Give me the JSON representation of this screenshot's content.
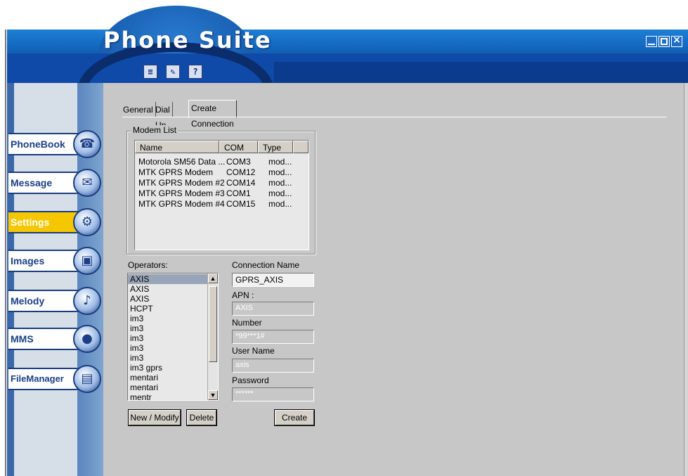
{
  "app": {
    "title": "Phone Suite"
  },
  "toolbar": {
    "icons": [
      "notes-icon",
      "edit-icon",
      "help-icon"
    ],
    "help_label": "?"
  },
  "sidebar": {
    "items": [
      {
        "label": "PhoneBook",
        "icon": "phone-icon",
        "active": false
      },
      {
        "label": "Message",
        "icon": "envelope-icon",
        "active": false
      },
      {
        "label": "Settings",
        "icon": "gear-icon",
        "active": true
      },
      {
        "label": "Images",
        "icon": "picture-icon",
        "active": false
      },
      {
        "label": "Melody",
        "icon": "saxophone-icon",
        "active": false
      },
      {
        "label": "MMS",
        "icon": "balloon-icon",
        "active": false
      },
      {
        "label": "FileManager",
        "icon": "folder-icon",
        "active": false
      }
    ]
  },
  "tabs": [
    "General",
    "Dial Up",
    "Create Connection"
  ],
  "modem_list": {
    "title": "Modem List",
    "columns": [
      "Name",
      "COM",
      "Type"
    ],
    "rows": [
      [
        "Motorola SM56 Data ...",
        "COM3",
        "mod..."
      ],
      [
        "MTK GPRS Modem",
        "COM12",
        "mod..."
      ],
      [
        "MTK GPRS Modem #2",
        "COM14",
        "mod..."
      ],
      [
        "MTK GPRS Modem #3",
        "COM1",
        "mod..."
      ],
      [
        "MTK GPRS Modem #4",
        "COM15",
        "mod..."
      ]
    ]
  },
  "operators": {
    "label": "Operators:",
    "items": [
      "AXIS",
      "AXIS",
      "AXIS",
      "HCPT",
      "im3",
      "im3",
      "im3",
      "im3",
      "im3",
      "im3 gprs",
      "mentari",
      "mentari",
      "mentr"
    ]
  },
  "form": {
    "connection_name_label": "Connection Name",
    "connection_name_value": "GPRS_AXIS",
    "apn_label": "APN :",
    "apn_value": "AXIS",
    "number_label": "Number",
    "number_value": "*99***1#",
    "username_label": "User Name",
    "username_value": "axis",
    "password_label": "Password",
    "password_value": "******"
  },
  "buttons": {
    "new_modify": "New / Modify",
    "delete": "Delete",
    "create": "Create"
  }
}
